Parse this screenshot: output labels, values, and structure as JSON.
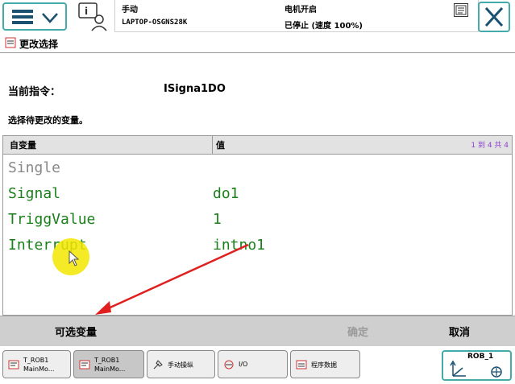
{
  "header": {
    "mode": "手动",
    "host": "LAPTOP-OSGNS28K",
    "motor": "电机开启",
    "state": "已停止 (速度 100%)"
  },
  "subheader": {
    "title": "更改选择"
  },
  "body": {
    "current_label": "当前指令：",
    "current_value": "ISigna1DO",
    "instruction": "选择待更改的变量。"
  },
  "table": {
    "headers": {
      "argument": "自变量",
      "value": "值",
      "count": "1 到 4 共 4"
    },
    "rows": [
      {
        "name": "Single",
        "value": ""
      },
      {
        "name": "Signal",
        "value": "do1"
      },
      {
        "name": "TriggValue",
        "value": "1"
      },
      {
        "name": "Interrupt",
        "value": "intno1"
      }
    ]
  },
  "actions": {
    "optional": "可选变量",
    "ok": "确定",
    "cancel": "取消"
  },
  "taskbar": {
    "items": [
      {
        "line1": "T_ROB1",
        "line2": "MainMo..."
      },
      {
        "line1": "T_ROB1",
        "line2": "MainMo..."
      },
      {
        "line1": "手动操纵",
        "line2": ""
      },
      {
        "line1": "I/O",
        "line2": ""
      },
      {
        "line1": "程序数据",
        "line2": ""
      }
    ],
    "robot": "ROB_1"
  },
  "colors": {
    "value_green": "#1b7f1b",
    "accent_teal": "#44aaaa",
    "count_purple": "#8a3fd0"
  },
  "icons": [
    "menu-icon",
    "chevron-down-icon",
    "operator-icon",
    "close-icon",
    "edit-icon",
    "program-icon",
    "jog-icon",
    "io-icon",
    "data-icon",
    "coordinate-icon"
  ]
}
